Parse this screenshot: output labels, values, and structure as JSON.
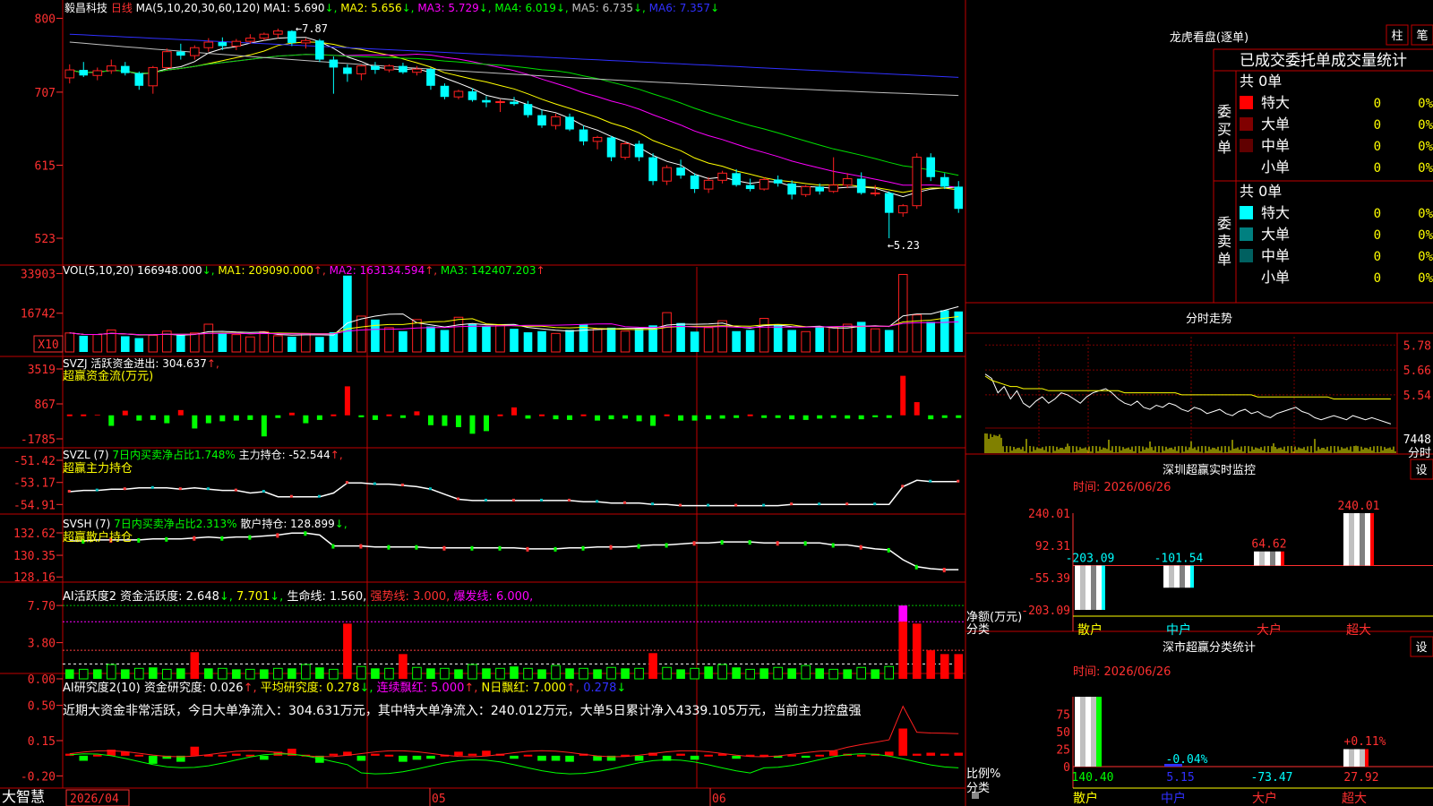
{
  "app": {
    "name": "大智慧",
    "date_tick": "2026/04"
  },
  "colors": {
    "up": "#ff2020",
    "down": "#00ffff",
    "frame": "#c00000",
    "ma1": "#ffffff",
    "ma2": "#ffff00",
    "ma3": "#ff00ff",
    "ma4": "#00e000",
    "ma5": "#c0c0c0",
    "ma6": "#3030ff",
    "pos_bar": "#ff0000",
    "neg_bar": "#00ff00"
  },
  "main_chart": {
    "stock": "毅昌科技",
    "period": "日线",
    "ma_label": "MA(5,10,20,30,60,120)",
    "ma": [
      {
        "name": "MA1:",
        "value": "5.690",
        "trend": "↓"
      },
      {
        "name": "MA2:",
        "value": "5.656",
        "trend": "↓"
      },
      {
        "name": "MA3:",
        "value": "5.729",
        "trend": "↓"
      },
      {
        "name": "MA4:",
        "value": "6.019",
        "trend": "↓"
      },
      {
        "name": "MA5:",
        "value": "6.735",
        "trend": "↓"
      },
      {
        "name": "MA6:",
        "value": "7.357",
        "trend": "↓"
      }
    ],
    "y_labels": [
      "800",
      "707",
      "615",
      "523"
    ],
    "high_mark": "←7.87",
    "low_mark": "←5.23",
    "candles": [
      [
        7.25,
        7.42,
        7.18,
        7.35
      ],
      [
        7.35,
        7.45,
        7.26,
        7.28
      ],
      [
        7.28,
        7.38,
        7.22,
        7.34
      ],
      [
        7.34,
        7.48,
        7.3,
        7.4
      ],
      [
        7.4,
        7.45,
        7.28,
        7.31
      ],
      [
        7.31,
        7.33,
        7.1,
        7.15
      ],
      [
        7.15,
        7.4,
        7.05,
        7.38
      ],
      [
        7.38,
        7.62,
        7.35,
        7.58
      ],
      [
        7.58,
        7.68,
        7.48,
        7.53
      ],
      [
        7.53,
        7.66,
        7.48,
        7.63
      ],
      [
        7.63,
        7.75,
        7.58,
        7.7
      ],
      [
        7.7,
        7.76,
        7.6,
        7.65
      ],
      [
        7.65,
        7.74,
        7.6,
        7.71
      ],
      [
        7.71,
        7.8,
        7.68,
        7.75
      ],
      [
        7.75,
        7.82,
        7.72,
        7.8
      ],
      [
        7.8,
        7.87,
        7.75,
        7.84
      ],
      [
        7.84,
        7.85,
        7.65,
        7.69
      ],
      [
        7.69,
        7.75,
        7.62,
        7.72
      ],
      [
        7.72,
        7.74,
        7.45,
        7.48
      ],
      [
        7.48,
        7.52,
        7.05,
        7.38
      ],
      [
        7.38,
        7.42,
        7.2,
        7.3
      ],
      [
        7.3,
        7.42,
        7.22,
        7.4
      ],
      [
        7.4,
        7.45,
        7.3,
        7.35
      ],
      [
        7.35,
        7.42,
        7.32,
        7.4
      ],
      [
        7.4,
        7.44,
        7.3,
        7.32
      ],
      [
        7.32,
        7.4,
        7.28,
        7.36
      ],
      [
        7.36,
        7.38,
        7.1,
        7.15
      ],
      [
        7.15,
        7.18,
        6.98,
        7.01
      ],
      [
        7.01,
        7.1,
        6.98,
        7.08
      ],
      [
        7.08,
        7.12,
        6.95,
        6.97
      ],
      [
        6.97,
        7.02,
        6.88,
        6.94
      ],
      [
        6.94,
        6.98,
        6.82,
        6.95
      ],
      [
        6.95,
        7.01,
        6.9,
        6.92
      ],
      [
        6.92,
        6.96,
        6.75,
        6.78
      ],
      [
        6.78,
        6.85,
        6.62,
        6.65
      ],
      [
        6.65,
        6.8,
        6.6,
        6.76
      ],
      [
        6.76,
        6.8,
        6.58,
        6.6
      ],
      [
        6.6,
        6.65,
        6.4,
        6.45
      ],
      [
        6.45,
        6.52,
        6.35,
        6.5
      ],
      [
        6.5,
        6.52,
        6.2,
        6.25
      ],
      [
        6.25,
        6.45,
        6.22,
        6.42
      ],
      [
        6.42,
        6.46,
        6.2,
        6.25
      ],
      [
        6.25,
        6.3,
        5.9,
        5.95
      ],
      [
        5.95,
        6.15,
        5.9,
        6.12
      ],
      [
        6.12,
        6.22,
        5.98,
        6.02
      ],
      [
        6.02,
        6.05,
        5.8,
        5.85
      ],
      [
        5.85,
        6.0,
        5.8,
        5.96
      ],
      [
        5.96,
        6.08,
        5.92,
        6.05
      ],
      [
        6.05,
        6.1,
        5.88,
        5.9
      ],
      [
        5.9,
        5.98,
        5.82,
        5.85
      ],
      [
        5.85,
        6.0,
        5.83,
        5.97
      ],
      [
        5.97,
        6.02,
        5.88,
        5.92
      ],
      [
        5.92,
        5.96,
        5.72,
        5.78
      ],
      [
        5.78,
        5.9,
        5.75,
        5.88
      ],
      [
        5.88,
        5.92,
        5.78,
        5.82
      ],
      [
        5.82,
        6.25,
        5.8,
        5.9
      ],
      [
        5.9,
        6.05,
        5.86,
        5.98
      ],
      [
        5.98,
        6.06,
        5.78,
        5.8
      ],
      [
        5.8,
        5.9,
        5.76,
        5.8
      ],
      [
        5.8,
        5.82,
        5.23,
        5.55
      ],
      [
        5.55,
        5.66,
        5.5,
        5.64
      ],
      [
        5.64,
        6.3,
        5.6,
        6.25
      ],
      [
        6.25,
        6.3,
        5.95,
        6.0
      ],
      [
        6.0,
        6.05,
        5.85,
        5.88
      ],
      [
        5.88,
        5.95,
        5.55,
        5.6
      ]
    ],
    "date_ticks": [
      "05",
      "06"
    ]
  },
  "vol_panel": {
    "label": "VOL(5,10,20)",
    "value": "166948.000",
    "value_trend": "↓",
    "ma": [
      {
        "name": "MA1:",
        "value": "209090.000",
        "trend": "↑"
      },
      {
        "name": "MA2:",
        "value": "163134.594",
        "trend": "↑"
      },
      {
        "name": "MA3:",
        "value": "142407.203",
        "trend": "↑"
      }
    ],
    "y_labels": [
      "33903",
      "16742"
    ],
    "unit": "X10",
    "values": [
      8200,
      7000,
      7500,
      9500,
      6800,
      6000,
      7200,
      9000,
      7300,
      8200,
      12000,
      8000,
      7500,
      6500,
      8800,
      7000,
      6600,
      8000,
      6500,
      8500,
      33000,
      15500,
      14000,
      10500,
      9000,
      14000,
      11000,
      9500,
      15000,
      12000,
      11000,
      11500,
      10000,
      8500,
      9000,
      8000,
      9500,
      12000,
      9800,
      10500,
      9000,
      10000,
      11500,
      17000,
      12500,
      8800,
      10500,
      13500,
      9000,
      9500,
      14500,
      12000,
      9500,
      8800,
      11000,
      10500,
      12000,
      13000,
      10000,
      9500,
      33500,
      16000,
      13000,
      18000,
      17500
    ]
  },
  "svzj_panel": {
    "name": "SVZJ",
    "title": "活跃资金进出:",
    "value": "304.637",
    "trend": "↑",
    "sub": "超赢资金流(万元)",
    "y_labels": [
      "3519",
      "867",
      "-1785"
    ],
    "values": [
      0,
      0,
      50,
      -800,
      350,
      -400,
      -350,
      -600,
      400,
      -1000,
      -600,
      -450,
      -400,
      -350,
      -1600,
      -200,
      200,
      -600,
      -350,
      0,
      2200,
      -150,
      -350,
      0,
      -200,
      300,
      -750,
      -800,
      -900,
      -1400,
      -1200,
      0,
      600,
      -250,
      0,
      -300,
      -350,
      0,
      -400,
      -300,
      -250,
      -450,
      -800,
      0,
      -400,
      -400,
      -300,
      -250,
      -200,
      0,
      -200,
      -200,
      -300,
      -350,
      -250,
      -200,
      -250,
      -300,
      -150,
      -200,
      3000,
      1000,
      -300,
      -200,
      -200
    ]
  },
  "svzl_panel": {
    "name": "SVZL",
    "period": "(7)",
    "ratio_label": "7日内买卖净占比1.748%",
    "title": "主力持仓:",
    "value": "-52.544",
    "trend": "↑",
    "sub": "超赢主力持仓",
    "y_labels": [
      "-51.42",
      "-53.17",
      "-54.91"
    ],
    "values": [
      -53.9,
      -53.8,
      -53.8,
      -53.7,
      -53.7,
      -53.6,
      -53.6,
      -53.6,
      -53.7,
      -53.6,
      -53.7,
      -53.8,
      -53.8,
      -54.0,
      -53.9,
      -54.3,
      -54.3,
      -54.3,
      -54.3,
      -54.0,
      -53.2,
      -53.2,
      -53.3,
      -53.3,
      -53.4,
      -53.5,
      -53.7,
      -54.1,
      -54.5,
      -54.6,
      -54.6,
      -54.6,
      -54.6,
      -54.6,
      -54.6,
      -54.6,
      -54.6,
      -54.7,
      -54.7,
      -54.8,
      -54.8,
      -54.8,
      -54.9,
      -54.9,
      -55.0,
      -55.0,
      -55.0,
      -55.0,
      -55.0,
      -55.0,
      -55.0,
      -55.0,
      -54.9,
      -54.9,
      -54.9,
      -54.9,
      -54.9,
      -54.9,
      -54.9,
      -54.9,
      -53.5,
      -53.0,
      -53.1,
      -53.1,
      -53.1
    ]
  },
  "svsh_panel": {
    "name": "SVSH",
    "period": "(7)",
    "ratio_label": "7日内买卖净占比2.313%",
    "title": "散户持仓:",
    "value": "128.899",
    "trend": "↓",
    "sub": "超赢散户持仓",
    "y_labels": [
      "132.62",
      "130.35",
      "128.16"
    ],
    "values": [
      131.8,
      131.8,
      131.9,
      131.9,
      131.9,
      131.9,
      132.0,
      132.0,
      132.0,
      132.1,
      132.2,
      132.1,
      132.2,
      132.2,
      132.3,
      132.4,
      132.6,
      132.6,
      132.4,
      131.3,
      131.3,
      131.3,
      131.2,
      131.2,
      131.2,
      131.2,
      131.1,
      131.1,
      131.1,
      131.1,
      131.1,
      131.1,
      131.1,
      131.0,
      131.0,
      131.0,
      131.1,
      131.1,
      131.2,
      131.2,
      131.2,
      131.3,
      131.4,
      131.4,
      131.5,
      131.6,
      131.6,
      131.7,
      131.7,
      131.7,
      131.6,
      131.6,
      131.6,
      131.6,
      131.6,
      131.4,
      131.4,
      131.2,
      131.0,
      130.9,
      129.9,
      129.2,
      129.0,
      128.9,
      128.9
    ]
  },
  "ai_active_panel": {
    "name": "AI活跃度2",
    "title": "资金活跃度:",
    "value": "2.648",
    "trend": "↓",
    "extra": [
      {
        "text": "7.701",
        "trend": "↓"
      }
    ],
    "life_label": "生命线:",
    "life_value": "1.560",
    "strong_label": "强势线:",
    "strong_value": "3.000",
    "burst_label": "爆发线:",
    "burst_value": "6.000",
    "y_labels": [
      "7.70",
      "3.80",
      "0.00"
    ],
    "values": [
      1.0,
      1.0,
      1.0,
      1.5,
      1.0,
      1.1,
      1.2,
      1.0,
      1.1,
      2.8,
      1.1,
      1.1,
      1.0,
      1.0,
      1.0,
      1.1,
      1.1,
      1.5,
      1.2,
      1.0,
      5.8,
      1.3,
      1.1,
      1.1,
      2.6,
      1.2,
      1.1,
      1.1,
      1.0,
      1.5,
      1.1,
      1.1,
      1.3,
      1.1,
      1.0,
      1.4,
      1.1,
      1.1,
      1.0,
      1.2,
      1.1,
      1.1,
      2.7,
      1.2,
      1.0,
      1.1,
      1.3,
      1.5,
      1.2,
      1.0,
      1.1,
      1.2,
      1.1,
      1.4,
      1.1,
      1.0,
      1.0,
      1.2,
      1.0,
      1.3,
      7.7,
      5.8,
      3.0,
      2.6,
      2.6
    ]
  },
  "ai_research_panel": {
    "name": "AI研究度2(10)",
    "title": "资金研究度:",
    "value": "0.026",
    "trend": "↑",
    "avg_label": "平均研究度:",
    "avg_value": "0.278",
    "avg_trend": "↓",
    "cont_label": "连续飘红:",
    "cont_value": "5.000",
    "cont_trend": "↑",
    "n_label": "N日飘红:",
    "n_value": "7.000",
    "n_trend": "↑",
    "tail_value": "0.278",
    "tail_trend": "↓",
    "comment": "近期大资金非常活跃，今日大单净流入：304.631万元，其中特大单净流入：240.012万元，大单5日累计净入4339.105万元，当前主力控盘强",
    "y_labels": [
      "0.50",
      "0.15",
      "-0.20"
    ],
    "values": [
      0.02,
      -0.05,
      0.01,
      0.06,
      0.04,
      0.01,
      -0.08,
      -0.03,
      -0.06,
      0.09,
      0.01,
      0.01,
      0.02,
      0.01,
      -0.04,
      0.04,
      0.07,
      0.01,
      -0.07,
      0.02,
      0.04,
      -0.05,
      0.02,
      0.01,
      -0.06,
      -0.04,
      -0.03,
      0.01,
      0.04,
      0.02,
      0.05,
      0.02,
      -0.03,
      0.01,
      -0.05,
      -0.05,
      -0.06,
      0.02,
      -0.05,
      -0.05,
      0.01,
      -0.05,
      0.03,
      -0.05,
      0.02,
      -0.04,
      0.01,
      0.02,
      -0.03,
      0.01,
      0.01,
      -0.02,
      0.01,
      -0.02,
      0.01,
      0.05,
      0.02,
      0.01,
      0.02,
      0.04,
      0.27,
      0.02,
      0.03,
      0.02,
      0.03
    ]
  },
  "lhb": {
    "title": "龙虎看盘(逐单)",
    "btn1": "柱",
    "btn2": "笔",
    "header": "已成交委托单成交量统计",
    "buy_group": "委买单",
    "sell_group": "委卖单",
    "buy_total": "共 0单",
    "sell_total": "共 0单",
    "buy_rows": [
      {
        "color": "#ff0000",
        "label": "特大",
        "qty": "0",
        "pct": "0%"
      },
      {
        "color": "#800000",
        "label": "大单",
        "qty": "0",
        "pct": "0%"
      },
      {
        "color": "#600000",
        "label": "中单",
        "qty": "0",
        "pct": "0%"
      },
      {
        "color": "",
        "label": "小单",
        "qty": "0",
        "pct": "0%"
      }
    ],
    "sell_rows": [
      {
        "color": "#00ffff",
        "label": "特大",
        "qty": "0",
        "pct": "0%"
      },
      {
        "color": "#008080",
        "label": "大单",
        "qty": "0",
        "pct": "0%"
      },
      {
        "color": "#006060",
        "label": "中单",
        "qty": "0",
        "pct": "0%"
      },
      {
        "color": "",
        "label": "小单",
        "qty": "0",
        "pct": "0%"
      }
    ]
  },
  "intraday": {
    "title": "分时走势",
    "y_labels": [
      "5.78",
      "5.66",
      "5.54"
    ],
    "vol_label": "7448",
    "unit_label": "分时",
    "price": [
      5.64,
      5.62,
      5.55,
      5.58,
      5.52,
      5.56,
      5.5,
      5.48,
      5.51,
      5.53,
      5.5,
      5.52,
      5.55,
      5.54,
      5.52,
      5.5,
      5.53,
      5.55,
      5.56,
      5.57,
      5.55,
      5.52,
      5.5,
      5.49,
      5.51,
      5.48,
      5.47,
      5.49,
      5.48,
      5.5,
      5.49,
      5.47,
      5.46,
      5.48,
      5.47,
      5.45,
      5.46,
      5.47,
      5.45,
      5.44,
      5.46,
      5.47,
      5.45,
      5.46,
      5.44,
      5.43,
      5.45,
      5.46,
      5.47,
      5.48,
      5.46,
      5.45,
      5.43,
      5.42,
      5.43,
      5.44,
      5.43,
      5.42,
      5.44,
      5.43,
      5.42,
      5.43,
      5.42,
      5.41,
      5.4
    ],
    "avg": [
      5.63,
      5.61,
      5.6,
      5.59,
      5.58,
      5.58,
      5.57,
      5.57,
      5.57,
      5.57,
      5.56,
      5.56,
      5.56,
      5.56,
      5.56,
      5.56,
      5.56,
      5.56,
      5.56,
      5.56,
      5.56,
      5.56,
      5.55,
      5.55,
      5.55,
      5.55,
      5.55,
      5.55,
      5.55,
      5.55,
      5.55,
      5.54,
      5.54,
      5.54,
      5.54,
      5.54,
      5.54,
      5.54,
      5.54,
      5.54,
      5.54,
      5.54,
      5.54,
      5.53,
      5.53,
      5.53,
      5.53,
      5.53,
      5.53,
      5.53,
      5.53,
      5.53,
      5.53,
      5.53,
      5.53,
      5.52,
      5.52,
      5.52,
      5.52,
      5.52,
      5.52,
      5.52,
      5.52,
      5.52,
      5.52
    ]
  },
  "sz_monitor": {
    "title": "深圳超赢实时监控",
    "btn": "设",
    "time": "时间: 2026/06/26",
    "y_labels": [
      "240.01",
      "92.31",
      "-55.39",
      "-203.09"
    ],
    "axis_label": "净额(万元)",
    "cat_label": "分类",
    "categories": [
      "散户",
      "中户",
      "大户",
      "超大"
    ],
    "values": [
      -203.09,
      -101.54,
      64.62,
      240.01
    ],
    "value_labels": [
      "-203.09",
      "-101.54",
      "64.62",
      "240.01"
    ]
  },
  "sz_classify": {
    "title": "深市超赢分类统计",
    "btn": "设",
    "time": "时间: 2026/06/26",
    "y_labels": [
      "75",
      "50",
      "25",
      "0"
    ],
    "axis_label": "比例%",
    "cat_label": "分类",
    "categories": [
      "散户",
      "中户",
      "大户",
      "超大"
    ],
    "bar_values": [
      100,
      -0.04,
      0,
      0.11
    ],
    "bar_labels": [
      "",
      "-0.04%",
      "",
      "+0.11%"
    ],
    "bottom_values": [
      "140.40",
      "5.15",
      "-73.47",
      "27.92"
    ]
  }
}
